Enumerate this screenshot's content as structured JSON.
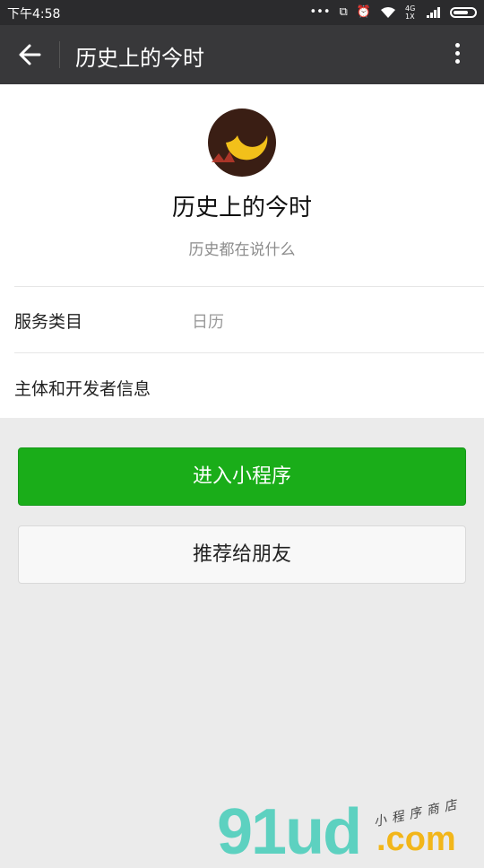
{
  "status_bar": {
    "time": "下午4:58",
    "network": "4G 1X"
  },
  "app_bar": {
    "title": "历史上的今时",
    "back_icon": "arrow-left-icon",
    "more_icon": "more-vertical-icon"
  },
  "profile": {
    "name": "历史上的今时",
    "description": "历史都在说什么",
    "avatar_colors": {
      "background": "#3a1e14",
      "moon": "#f2c01a",
      "accent": "#c0392b"
    }
  },
  "info_rows": [
    {
      "label": "服务类目",
      "value": "日历"
    },
    {
      "label": "主体和开发者信息",
      "value": ""
    }
  ],
  "actions": {
    "enter_label": "进入小程序",
    "recommend_label": "推荐给朋友"
  },
  "watermark": {
    "logo": "91ud",
    "suffix": ".com",
    "tagline": "小程序商店"
  },
  "colors": {
    "primary": "#1aad19",
    "app_bar": "#38383a",
    "status_bar": "#2b2b2d"
  }
}
